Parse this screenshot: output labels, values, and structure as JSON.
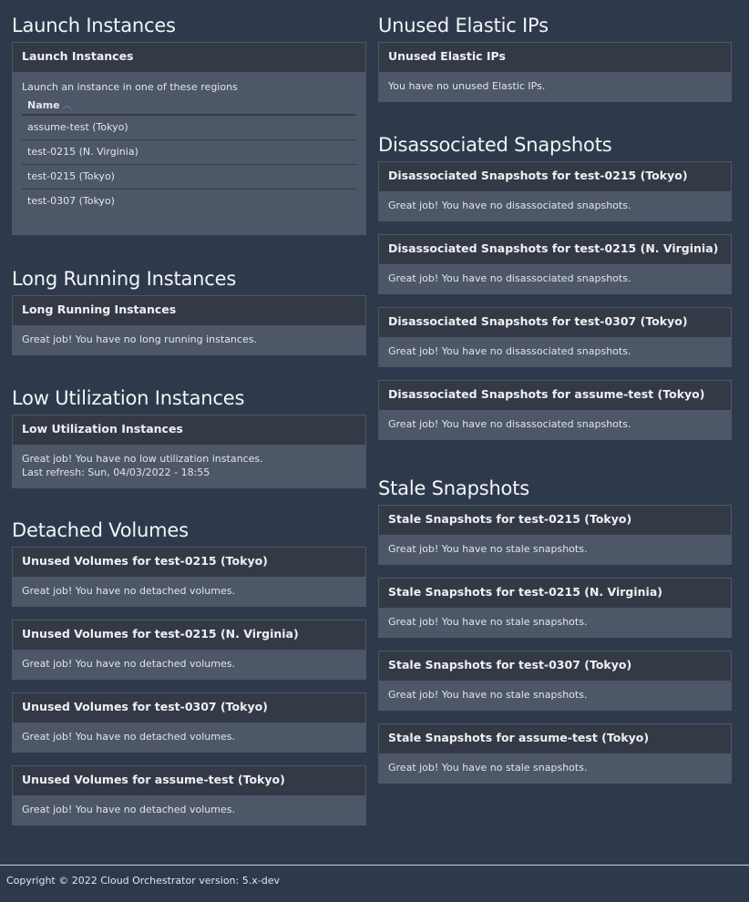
{
  "left": {
    "launch": {
      "title": "Launch Instances",
      "panel_title": "Launch Instances",
      "description": "Launch an instance in one of these regions",
      "column_header": "Name",
      "sort_icon": "chevron-up-icon",
      "rows": [
        "assume-test (Tokyo)",
        "test-0215 (N. Virginia)",
        "test-0215 (Tokyo)",
        "test-0307 (Tokyo)"
      ]
    },
    "long_running": {
      "title": "Long Running Instances",
      "panel_title": "Long Running Instances",
      "message": "Great job! You have no long running instances."
    },
    "low_util": {
      "title": "Low Utilization Instances",
      "panel_title": "Low Utilization Instances",
      "message": "Great job! You have no low utilization instances.",
      "refresh": "Last refresh: Sun, 04/03/2022 - 18:55"
    },
    "detached": {
      "title": "Detached Volumes",
      "panels": [
        {
          "title": "Unused Volumes for test-0215 (Tokyo)",
          "message": "Great job! You have no detached volumes."
        },
        {
          "title": "Unused Volumes for test-0215 (N. Virginia)",
          "message": "Great job! You have no detached volumes."
        },
        {
          "title": "Unused Volumes for test-0307 (Tokyo)",
          "message": "Great job! You have no detached volumes."
        },
        {
          "title": "Unused Volumes for assume-test (Tokyo)",
          "message": "Great job! You have no detached volumes."
        }
      ]
    }
  },
  "right": {
    "elastic": {
      "title": "Unused Elastic IPs",
      "panel_title": "Unused Elastic IPs",
      "message": "You have no unused Elastic IPs."
    },
    "disassociated": {
      "title": "Disassociated Snapshots",
      "panels": [
        {
          "title": "Disassociated Snapshots for test-0215 (Tokyo)",
          "message": "Great job! You have no disassociated snapshots."
        },
        {
          "title": "Disassociated Snapshots for test-0215 (N. Virginia)",
          "message": "Great job! You have no disassociated snapshots."
        },
        {
          "title": "Disassociated Snapshots for test-0307 (Tokyo)",
          "message": "Great job! You have no disassociated snapshots."
        },
        {
          "title": "Disassociated Snapshots for assume-test (Tokyo)",
          "message": "Great job! You have no disassociated snapshots."
        }
      ]
    },
    "stale": {
      "title": "Stale Snapshots",
      "panels": [
        {
          "title": "Stale Snapshots for test-0215 (Tokyo)",
          "message": "Great job! You have no stale snapshots."
        },
        {
          "title": "Stale Snapshots for test-0215 (N. Virginia)",
          "message": "Great job! You have no stale snapshots."
        },
        {
          "title": "Stale Snapshots for test-0307 (Tokyo)",
          "message": "Great job! You have no stale snapshots."
        },
        {
          "title": "Stale Snapshots for assume-test (Tokyo)",
          "message": "Great job! You have no stale snapshots."
        }
      ]
    }
  },
  "footer": {
    "text": "Copyright © 2022 Cloud Orchestrator version: 5.x-dev"
  },
  "colors": {
    "page_bg": "#2e3a4c",
    "panel_heading_bg": "#343a45",
    "panel_body_bg": "#4d5768",
    "sort_icon": "#7a93c0"
  }
}
